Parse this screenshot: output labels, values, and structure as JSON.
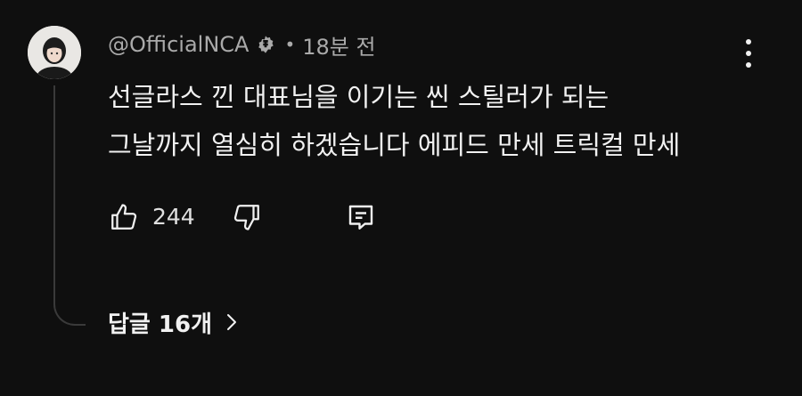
{
  "comment": {
    "author": "@OfficialNCA",
    "separator": "•",
    "timestamp": "18분 전",
    "lines": [
      "선글라스 낀 대표님을 이기는 씬 스틸러가 되는",
      "그날까지 열심히 하겠습니다 에피드 만세 트릭컬 만세"
    ],
    "like_count": "244",
    "replies_label": "답글 16개"
  },
  "icons": {
    "verified": "verified-badge-icon",
    "menu": "more-vert-icon",
    "like": "thumb-up-icon",
    "dislike": "thumb-down-icon",
    "reply": "comment-reply-icon",
    "replies": "chevron-right-icon"
  },
  "colors": {
    "background": "#0f0f0f",
    "text": "#f1f1f1",
    "secondary_text": "#aaaaaa",
    "thread_line": "#3a3a3a"
  }
}
